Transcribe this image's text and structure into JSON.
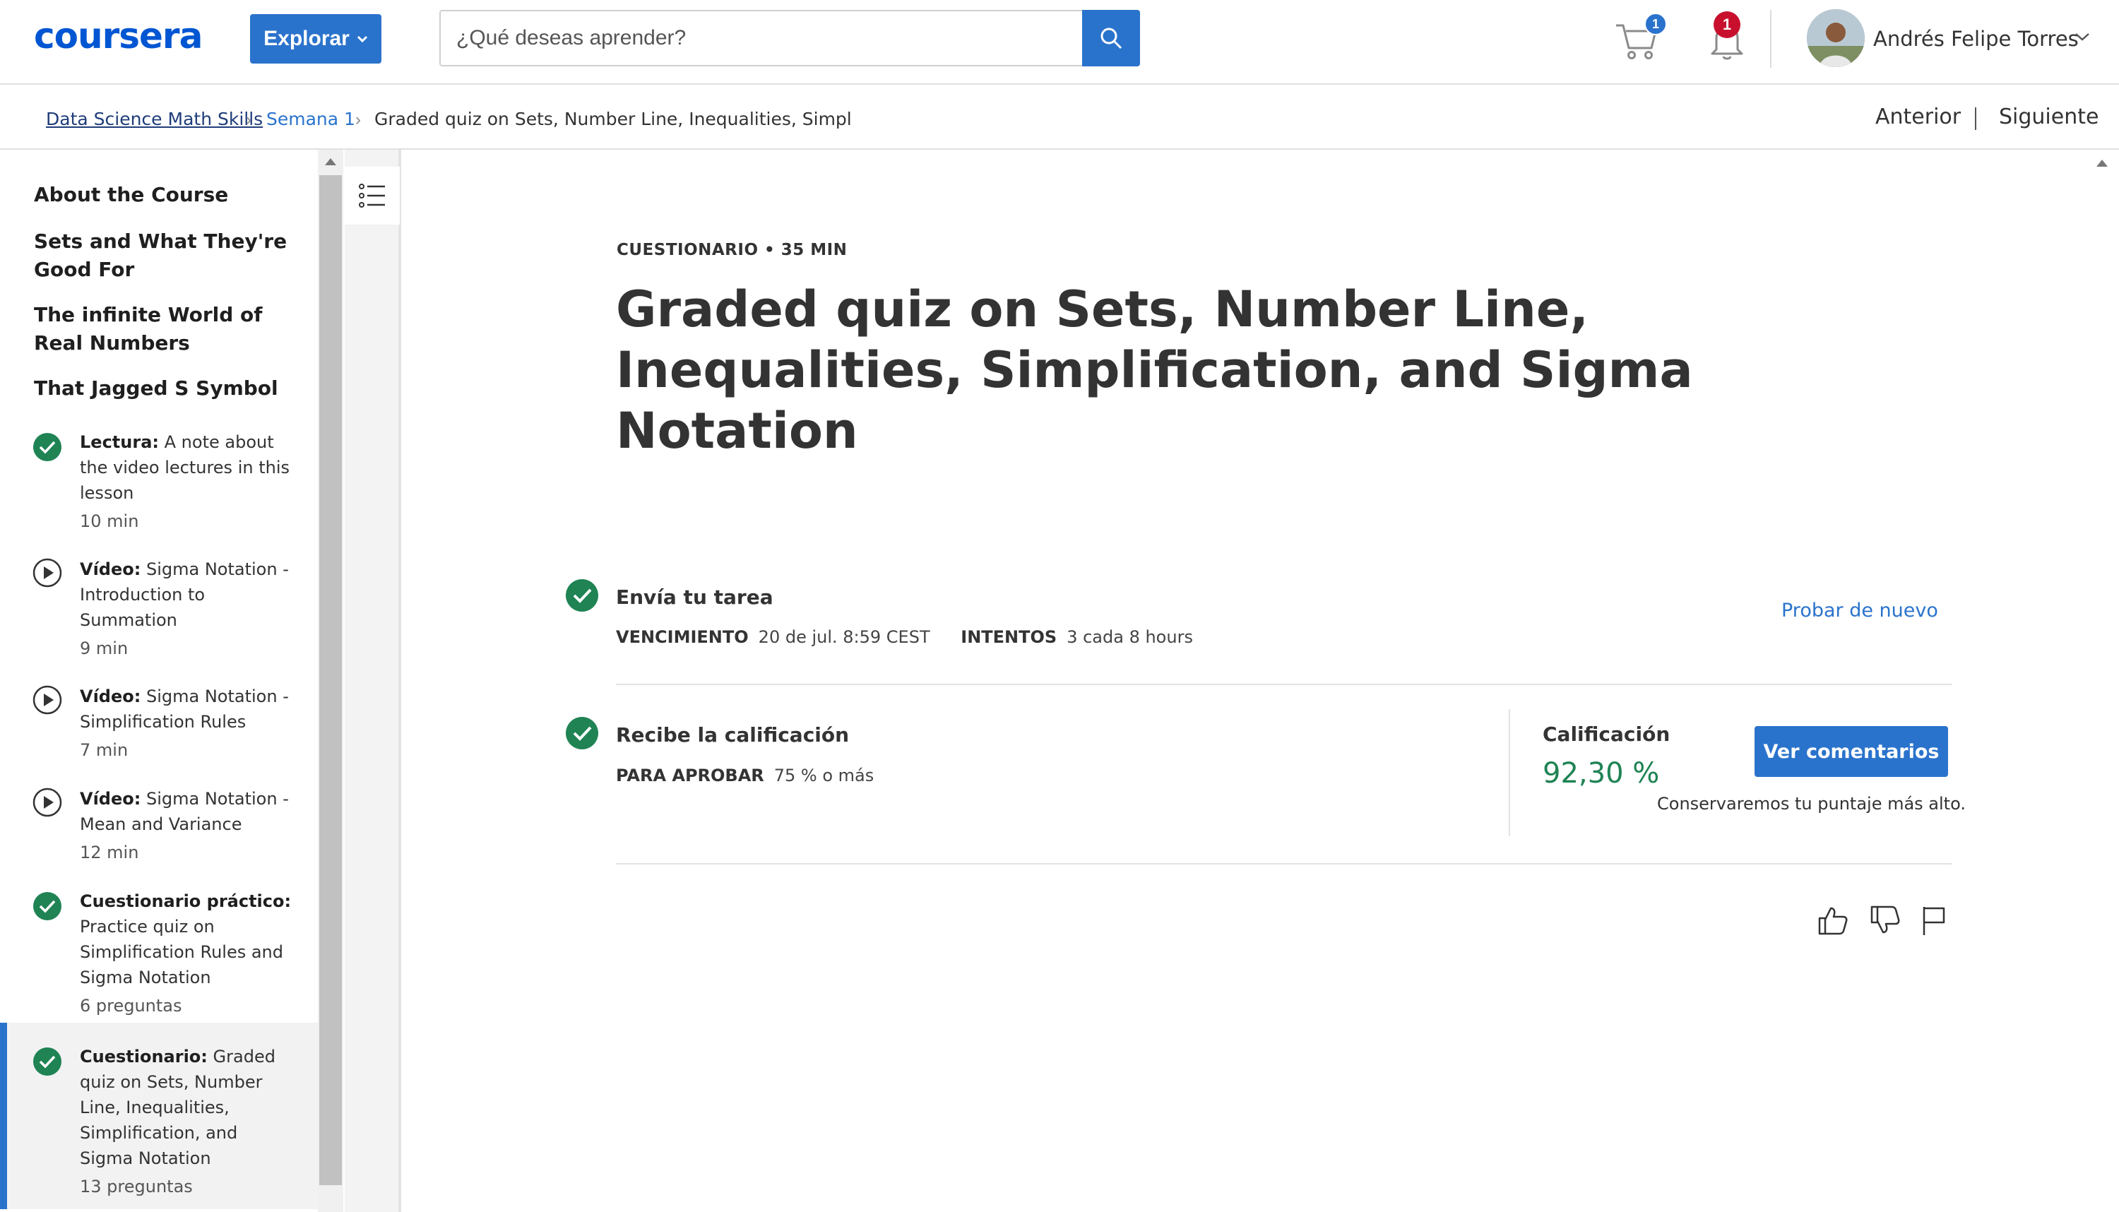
{
  "header": {
    "logo": "coursera",
    "explore_label": "Explorar",
    "search_placeholder": "¿Qué deseas aprender?",
    "cart_count": "1",
    "notifications_count": "1",
    "user_name": "Andrés Felipe Torres"
  },
  "breadcrumb": {
    "course": "Data Science Math Skills",
    "week": "Semana 1",
    "current": "Graded quiz on Sets, Number Line, Inequalities, Simpl",
    "prev_label": "Anterior",
    "next_label": "Siguiente"
  },
  "sidebar": {
    "sections": [
      "About the Course",
      "Sets and What They're Good For",
      "The infinite World of Real Numbers",
      "That Jagged S Symbol"
    ],
    "items": [
      {
        "icon": "check-circle-icon",
        "type": "Lectura:",
        "title": "A note about the video lectures in this lesson",
        "meta": "10 min"
      },
      {
        "icon": "play-circle-icon",
        "type": "Vídeo:",
        "title": "Sigma Notation - Introduction to Summation",
        "meta": "9 min"
      },
      {
        "icon": "play-circle-icon",
        "type": "Vídeo:",
        "title": "Sigma Notation - Simplification Rules",
        "meta": "7 min"
      },
      {
        "icon": "play-circle-icon",
        "type": "Vídeo:",
        "title": "Sigma Notation - Mean and Variance",
        "meta": "12 min"
      },
      {
        "icon": "check-circle-icon",
        "type": "Cuestionario práctico:",
        "title": "Practice quiz on Simplification Rules and Sigma Notation",
        "meta": "6 preguntas"
      },
      {
        "icon": "check-circle-icon",
        "type": "Cuestionario:",
        "title": "Graded quiz on Sets, Number Line, Inequalities, Simplification, and Sigma Notation",
        "meta": "13 preguntas",
        "active": true
      }
    ]
  },
  "main": {
    "kicker": "CUESTIONARIO • 35 MIN",
    "title": "Graded quiz on Sets, Number Line, Inequalities, Simplification, and Sigma Notation",
    "submit": {
      "title": "Envía tu tarea",
      "due_label": "VENCIMIENTO",
      "due_value": "20 de jul. 8:59 CEST",
      "attempts_label": "INTENTOS",
      "attempts_value": "3 cada 8 hours",
      "retry_label": "Probar de nuevo"
    },
    "grade": {
      "title": "Recibe la calificación",
      "pass_label": "PARA APROBAR",
      "pass_value": "75 % o más",
      "grade_label": "Calificación",
      "grade_value": "92,30 %",
      "feedback_label": "Ver comentarios",
      "keep_note": "Conservaremos tu puntaje más alto."
    }
  },
  "colors": {
    "brand_blue": "#0056d2",
    "accent_blue": "#2a73cc",
    "success_green": "#1f8354",
    "alert_red": "#c8102e"
  }
}
